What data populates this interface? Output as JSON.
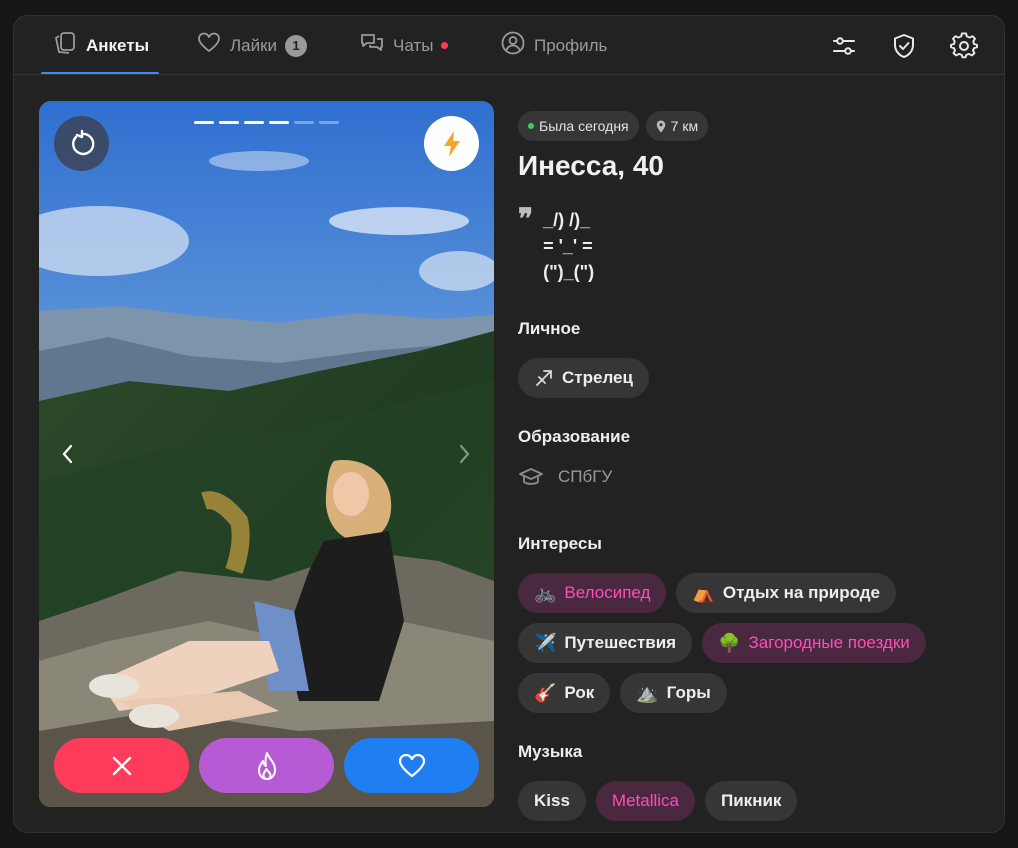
{
  "tabs": [
    {
      "label": "Анкеты",
      "icon": "cards-icon",
      "active": true
    },
    {
      "label": "Лайки",
      "icon": "heart-outline-icon",
      "badge": "1"
    },
    {
      "label": "Чаты",
      "icon": "chat-bubbles-icon",
      "unread_dot": true
    },
    {
      "label": "Профиль",
      "icon": "user-circle-icon"
    }
  ],
  "toolbar": {
    "filters_icon": "sliders-icon",
    "safety_icon": "shield-check-icon",
    "settings_icon": "gear-icon"
  },
  "photo": {
    "photos_total": 6,
    "current_photo": 4,
    "undo_icon": "undo-icon",
    "boost_icon": "lightning-icon",
    "actions": [
      {
        "name": "dislike",
        "icon": "close-icon",
        "color": "#ff3b5c"
      },
      {
        "name": "superlike",
        "icon": "flame-icon",
        "color": "#b65ad6"
      },
      {
        "name": "like",
        "icon": "heart-icon",
        "color": "#1f7ff2"
      }
    ]
  },
  "profile": {
    "status": "Была сегодня",
    "distance": "7 км",
    "name_age": "Инесса, 40",
    "bio_quote_mark": "❞",
    "bio": "_/) /)_\n= '_' =\n(\")_(\")",
    "sections": {
      "personal": {
        "title": "Личное",
        "items": [
          {
            "label": "Стрелец",
            "icon": "sagittarius-icon"
          }
        ]
      },
      "education": {
        "title": "Образование",
        "value": "СПбГУ",
        "icon": "graduation-cap-icon"
      },
      "interests": {
        "title": "Интересы",
        "items": [
          {
            "label": "Велосипед",
            "emoji": "🚲",
            "highlighted": true
          },
          {
            "label": "Отдых на природе",
            "emoji": "⛺",
            "highlighted": false
          },
          {
            "label": "Путешествия",
            "emoji": "✈️",
            "highlighted": false
          },
          {
            "label": "Загородные поездки",
            "emoji": "🌳",
            "highlighted": true
          },
          {
            "label": "Рок",
            "emoji": "🎸",
            "highlighted": false
          },
          {
            "label": "Горы",
            "emoji": "⛰️",
            "highlighted": false
          }
        ]
      },
      "music": {
        "title": "Музыка",
        "items": [
          {
            "label": "Kiss",
            "highlighted": false
          },
          {
            "label": "Metallica",
            "highlighted": true
          },
          {
            "label": "Пикник",
            "highlighted": false
          }
        ]
      }
    }
  },
  "colors": {
    "accent_blue": "#3d8ef0",
    "highlight_pink": "#ff4dbb",
    "highlight_bg": "#4a2840",
    "panel_bg": "#222222",
    "chip_bg": "#363636"
  }
}
